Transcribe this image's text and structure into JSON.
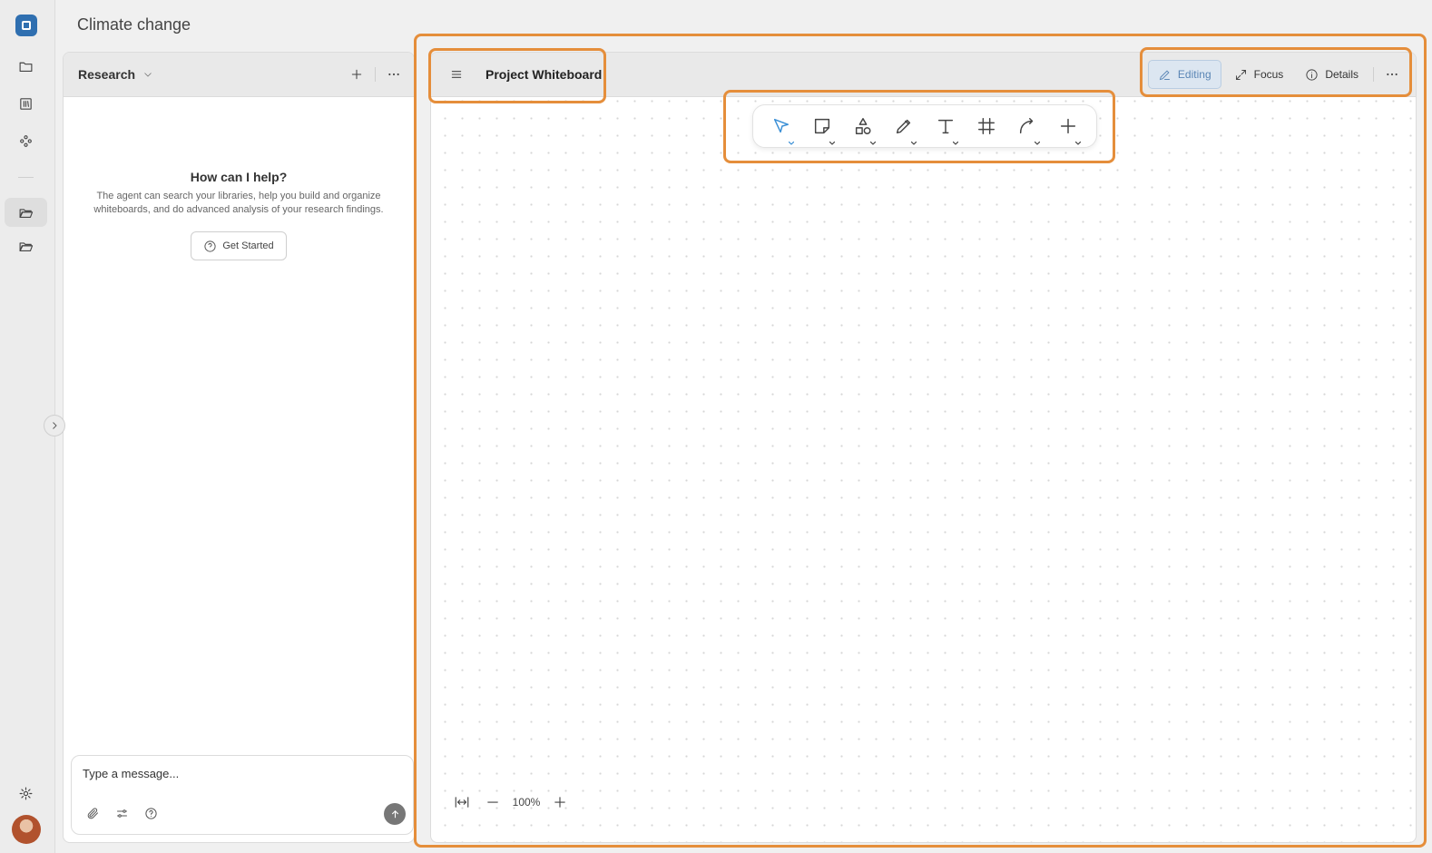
{
  "page": {
    "title": "Climate change"
  },
  "research": {
    "title": "Research",
    "help_heading": "How can I help?",
    "help_text": "The agent can search your libraries, help you build and organize whiteboards, and do advanced analysis of your research findings.",
    "get_started": "Get Started",
    "composer_placeholder": "Type a message..."
  },
  "whiteboard": {
    "title": "Project Whiteboard",
    "editing_label": "Editing",
    "focus_label": "Focus",
    "details_label": "Details",
    "zoom_level": "100%",
    "tools": [
      "select-tool",
      "sticky-note-tool",
      "shapes-tool",
      "pen-tool",
      "text-tool",
      "frame-tool",
      "connector-tool",
      "add-tool"
    ],
    "active_tool": "select-tool"
  },
  "colors": {
    "accent": "#3a8fd6",
    "editing_bg": "#dce6f1",
    "highlight": "#e58e3b",
    "brand": "#2f6fb0"
  }
}
